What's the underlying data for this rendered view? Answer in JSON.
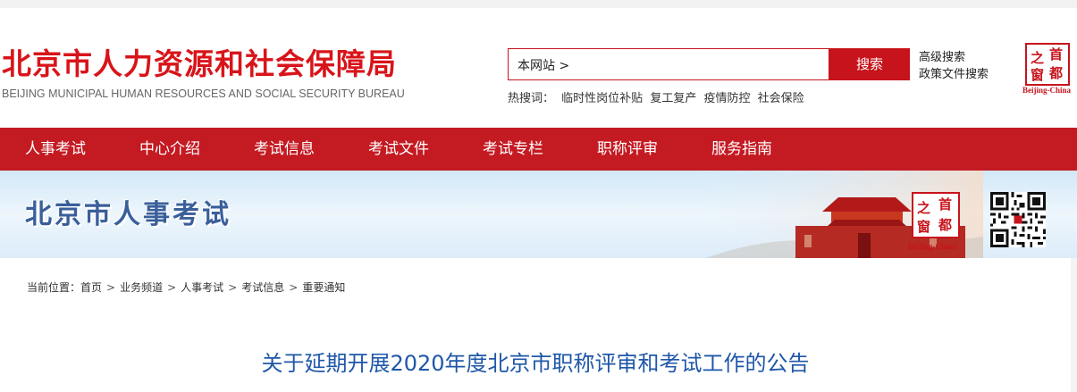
{
  "header": {
    "logo_cn": "北京市人力资源和社会保障局",
    "logo_en": "BEIJING MUNICIPAL HUMAN RESOURCES AND SOCIAL SECURITY BUREAU"
  },
  "search": {
    "scope_label": "本网站 >",
    "button_label": "搜索",
    "advanced_label": "高级搜索",
    "policy_label": "政策文件搜索",
    "hot_label": "热搜词：",
    "hot_words": [
      "临时性岗位补贴",
      "复工复产",
      "疫情防控",
      "社会保险"
    ]
  },
  "stamp": {
    "chars": [
      "之",
      "首",
      "窗",
      "都"
    ],
    "label": "Beijing-China"
  },
  "nav": {
    "items": [
      "人事考试",
      "中心介绍",
      "考试信息",
      "考试文件",
      "考试专栏",
      "职称评审",
      "服务指南"
    ]
  },
  "banner": {
    "title": "北京市人事考试"
  },
  "breadcrumb": {
    "prefix": "当前位置：",
    "items": [
      "首页",
      "业务频道",
      "人事考试",
      "考试信息",
      "重要通知"
    ],
    "separator": ">"
  },
  "article": {
    "title": "关于延期开展2020年度北京市职称评审和考试工作的公告"
  },
  "colors": {
    "brand_red": "#c7141c",
    "nav_red": "#c41a22",
    "title_blue": "#1f57a8",
    "banner_blue": "#3a5f9a"
  }
}
